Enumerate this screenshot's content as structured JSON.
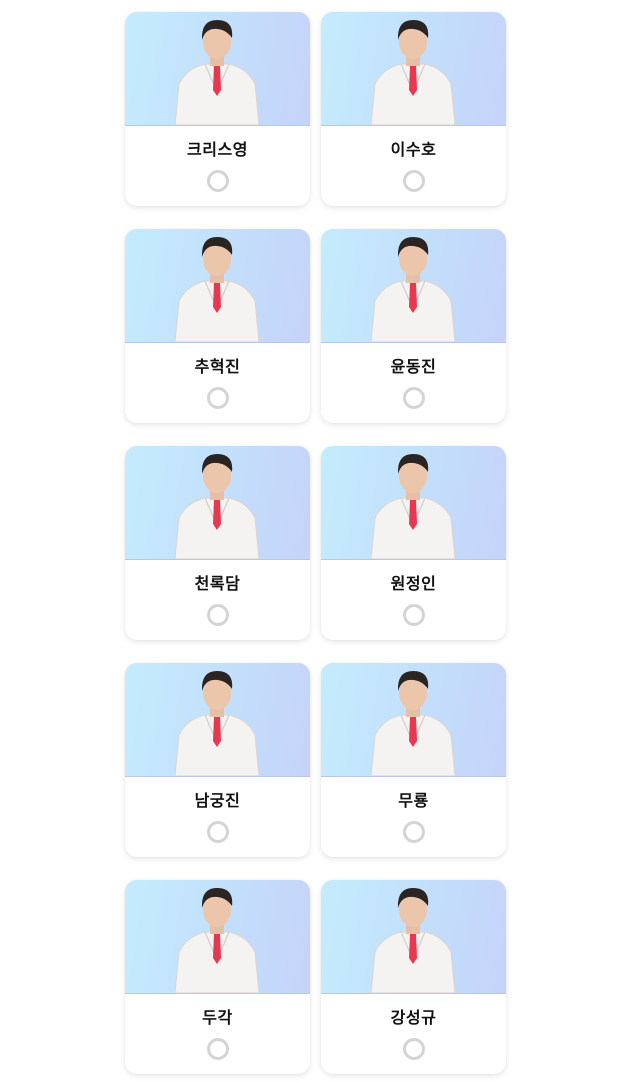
{
  "candidates": [
    {
      "name": "크리스영",
      "selected": false,
      "accent": "#e8384f"
    },
    {
      "name": "이수호",
      "selected": false,
      "accent": "#e8384f"
    },
    {
      "name": "추혁진",
      "selected": false,
      "accent": "#e8384f"
    },
    {
      "name": "윤동진",
      "selected": false,
      "accent": "#e8384f"
    },
    {
      "name": "천록담",
      "selected": false,
      "accent": "#e8384f"
    },
    {
      "name": "원정인",
      "selected": false,
      "accent": "#e8384f"
    },
    {
      "name": "남궁진",
      "selected": false,
      "accent": "#e8384f"
    },
    {
      "name": "무룡",
      "selected": false,
      "accent": "#e8384f"
    },
    {
      "name": "두각",
      "selected": false,
      "accent": "#e8384f"
    },
    {
      "name": "강성규",
      "selected": false,
      "accent": "#e8384f"
    }
  ]
}
